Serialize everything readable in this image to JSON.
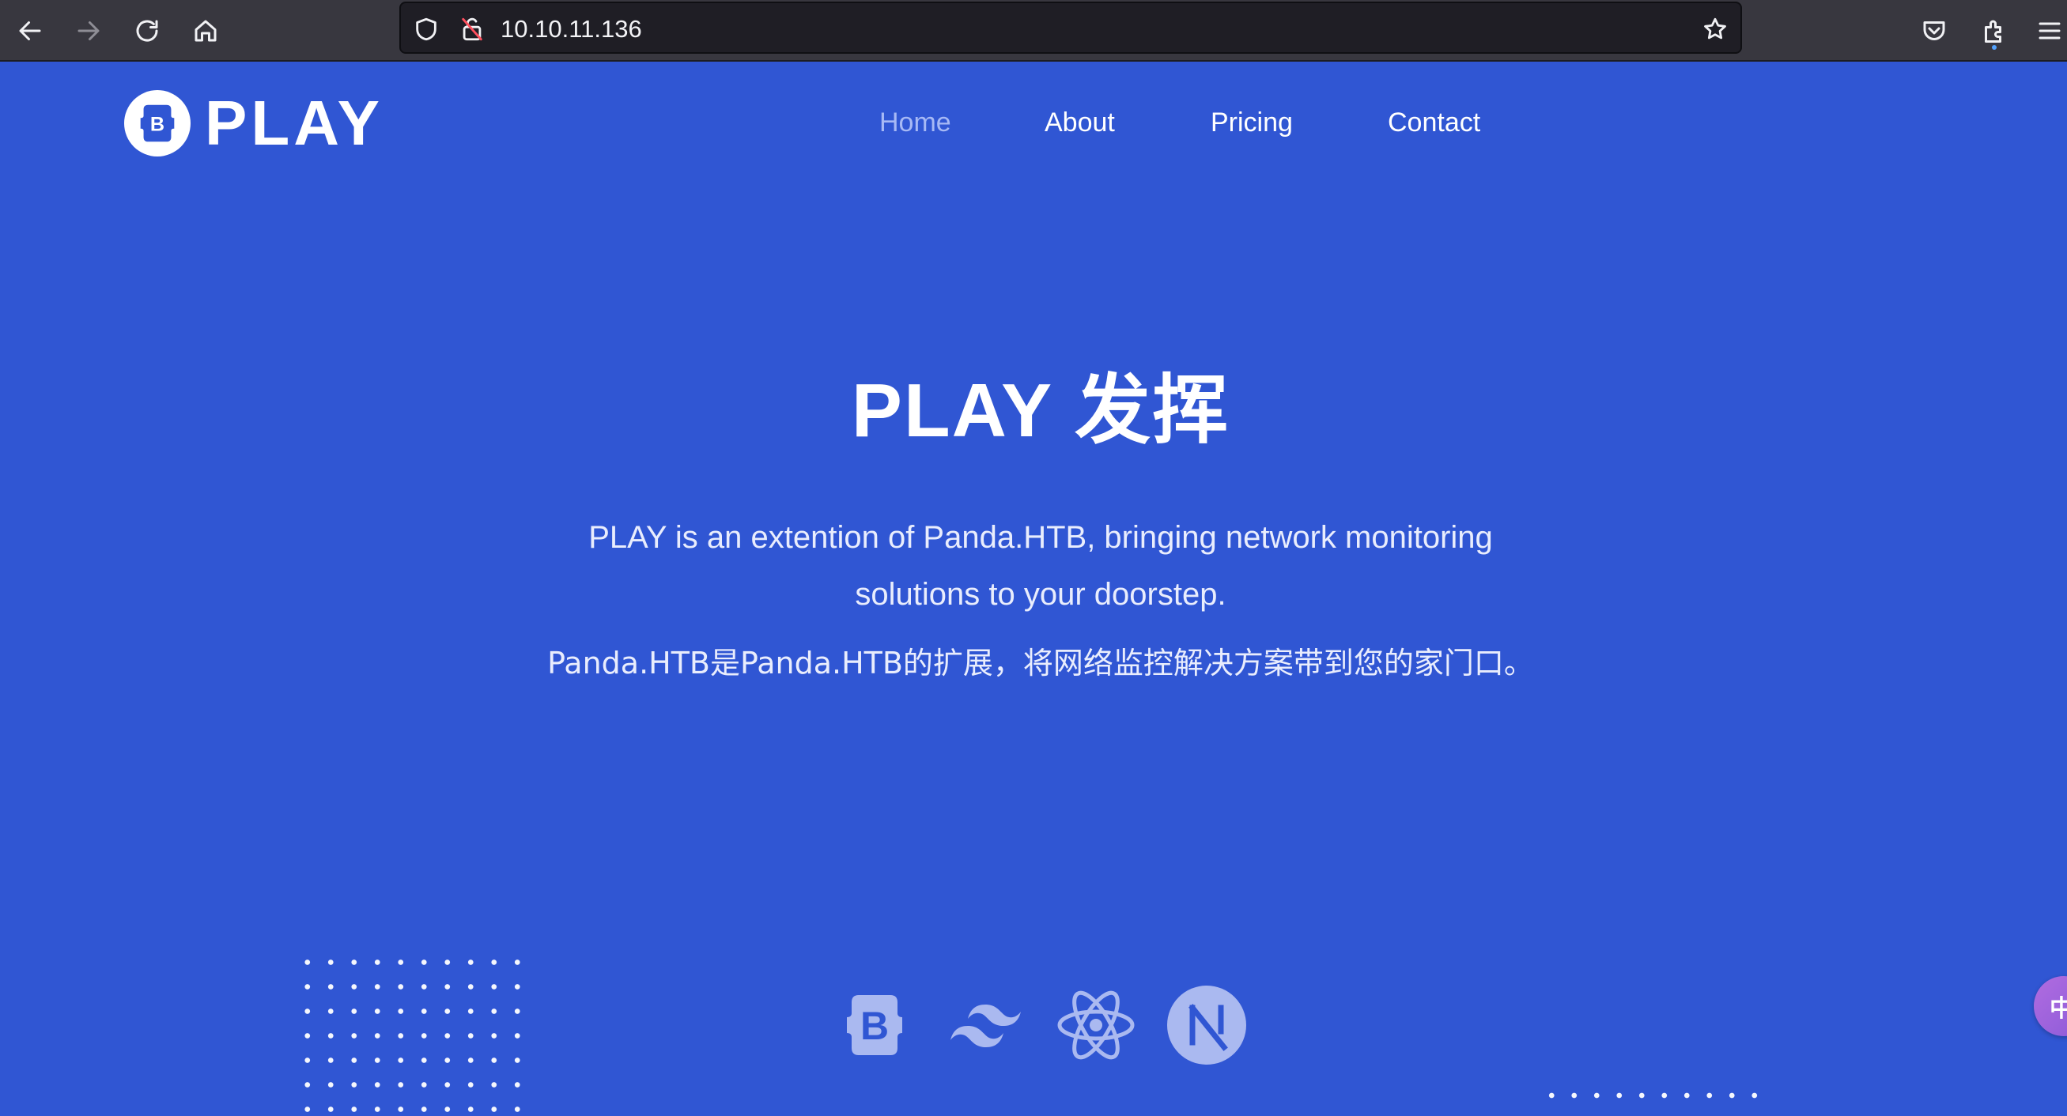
{
  "browser": {
    "url": "10.10.11.136",
    "icons": [
      "back-icon",
      "forward-icon",
      "reload-icon",
      "home-icon",
      "shield-icon",
      "insecure-lock-icon",
      "bookmark-star-icon",
      "pocket-icon",
      "extensions-icon",
      "menu-icon"
    ]
  },
  "site": {
    "logo_letter": "B",
    "logo_text": "PLAY",
    "nav": [
      {
        "label": "Home",
        "active": true
      },
      {
        "label": "About",
        "active": false
      },
      {
        "label": "Pricing",
        "active": false
      },
      {
        "label": "Contact",
        "active": false
      }
    ]
  },
  "hero": {
    "title": "PLAY 发挥",
    "description_en": "PLAY is an extention of Panda.HTB, bringing network monitoring solutions to your doorstep.",
    "description_zh": "Panda.HTB是Panda.HTB的扩展，将网络监控解决方案带到您的家门口。"
  },
  "tech_logos": [
    "bootstrap-icon",
    "tailwind-icon",
    "react-icon",
    "nextjs-icon"
  ],
  "floating_widget": {
    "glyph": "中"
  },
  "colors": {
    "page_bg": "#3056d3",
    "chrome_bg": "#38373f",
    "url_bg": "#1f1e25",
    "nav_active": "#a7b9f5",
    "tech_logo": "#aab9f0"
  }
}
